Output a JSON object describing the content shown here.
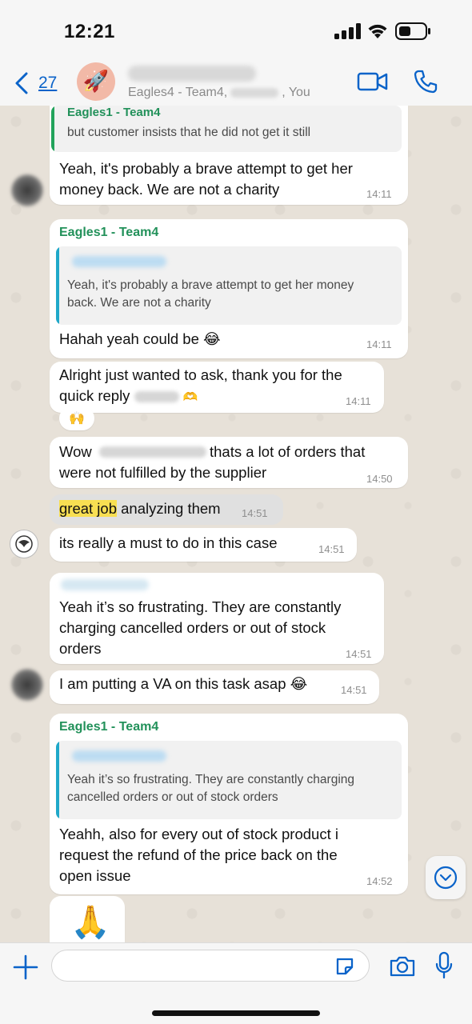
{
  "status_bar": {
    "time": "12:21"
  },
  "header": {
    "back_count": "27",
    "members_prefix": "Eagles4 - Team4,",
    "members_suffix": ", You",
    "avatar_emoji": "🚀"
  },
  "messages": [
    {
      "id": "m1",
      "quote_sender": "Eagles1 - Team4",
      "quote_text": "but customer insists that he did not get it still",
      "text_line1": "Yeah, it's probably a brave attempt to get her",
      "text_line2": "money back. We are not a charity",
      "time": "14:11"
    },
    {
      "id": "m2",
      "sender": "Eagles1 - Team4",
      "quote_text_line1": "Yeah, it's probably a brave attempt to get her money",
      "quote_text_line2": "back. We are not a charity",
      "text": "Hahah yeah could be",
      "emoji": "😂",
      "time": "14:11"
    },
    {
      "id": "m3",
      "text_line1": "Alright just wanted to ask, thank you for the",
      "text_line2": "quick reply",
      "emoji": "🫶",
      "time": "14:11",
      "reaction": "🙌"
    },
    {
      "id": "m4",
      "text_line1_start": "Wow",
      "text_line1_end": "thats a lot of orders that",
      "text_line2": "were not fulfilled by the supplier",
      "time": "14:50"
    },
    {
      "id": "m5",
      "highlighted": "great job",
      "text": " analyzing them",
      "time": "14:51"
    },
    {
      "id": "m6",
      "text": "its really a must to do in this case",
      "time": "14:51"
    },
    {
      "id": "m7",
      "text_line1": "Yeah it’s so frustrating. They are constantly",
      "text_line2": "charging cancelled orders or out of stock",
      "text_line3": "orders",
      "time": "14:51"
    },
    {
      "id": "m8",
      "text": "I am putting a VA on this task asap",
      "emoji": "😂",
      "time": "14:51"
    },
    {
      "id": "m9",
      "sender": "Eagles1 - Team4",
      "quote_text_line1": "Yeah it’s so frustrating. They are constantly charging",
      "quote_text_line2": "cancelled orders or out of stock orders",
      "text_line1": "Yeahh, also for every out of stock product i",
      "text_line2": "request the refund of the price back on the",
      "text_line3": "open issue",
      "time": "14:52"
    },
    {
      "id": "m10",
      "emoji": "🙏"
    }
  ],
  "input": {
    "placeholder": ""
  },
  "colors": {
    "sender_green": "#22915a",
    "link_blue": "#0a63c9",
    "quote_bar_green": "#22a35b",
    "quote_bar_blue": "#1fa8c9",
    "highlight_yellow": "#f8df52",
    "own_bubble": "#e0e0e0"
  },
  "icons": [
    "back-chevron-icon",
    "video-call-icon",
    "phone-icon",
    "plus-icon",
    "sticker-icon",
    "camera-icon",
    "microphone-icon",
    "scroll-down-icon",
    "signal-icon",
    "wifi-icon",
    "battery-icon"
  ]
}
